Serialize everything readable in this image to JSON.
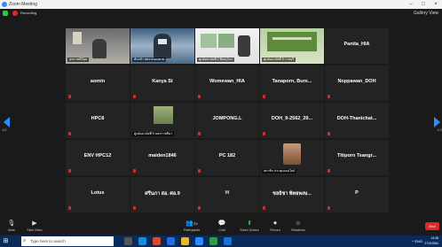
{
  "window": {
    "title": "Zoom Meeting",
    "minimize": "–",
    "maximize": "□",
    "close": "×"
  },
  "meeting": {
    "recording_label": "Recording",
    "view_button": "Gallery View"
  },
  "pagination": {
    "prev_page": "1/2",
    "next_page": "1/2"
  },
  "tiles": [
    {
      "name": "",
      "video_label": "สุขภาพดีมีสุข"
    },
    {
      "name": "",
      "video_label": "ต้นกล้า สสจ.หนองคาย"
    },
    {
      "name": "",
      "video_label": "ศูนย์อนามัยที่ 2 พิษณุโลก"
    },
    {
      "name": "",
      "video_label": "ศูนย์อนามัยที่ 5 ราชบุรี"
    },
    {
      "name": "Panita_HIA",
      "video_label": ""
    },
    {
      "name": "aomin",
      "video_label": ""
    },
    {
      "name": "Kanya St",
      "video_label": ""
    },
    {
      "name": "Womewan_HIA",
      "video_label": ""
    },
    {
      "name": "Tanaporn, Bure...",
      "video_label": ""
    },
    {
      "name": "Noppawan_DOH",
      "video_label": ""
    },
    {
      "name": "HPC8",
      "video_label": ""
    },
    {
      "name": "",
      "video_label": "ศูนย์อนามัยที่ 9 นครราชสีมา"
    },
    {
      "name": "JOMPONG.L",
      "video_label": ""
    },
    {
      "name": "DOH_9-2562_29...",
      "video_label": ""
    },
    {
      "name": "DOH-Thanichat...",
      "video_label": ""
    },
    {
      "name": "ENV HPC12",
      "video_label": ""
    },
    {
      "name": "maiden1846",
      "video_label": ""
    },
    {
      "name": "PC 182",
      "video_label": ""
    },
    {
      "name": "",
      "video_label": "สมาชิก ประชุมออนไลน์"
    },
    {
      "name": "Titiporn Tsangr...",
      "video_label": ""
    },
    {
      "name": "Lotus",
      "video_label": ""
    },
    {
      "name": "ศรีนภา สอ. ศอ.9",
      "video_label": ""
    },
    {
      "name": "H",
      "video_label": ""
    },
    {
      "name": "ชลธิชา พิทยพงษ...",
      "video_label": ""
    },
    {
      "name": "P",
      "video_label": ""
    }
  ],
  "toolbar": {
    "mute": "Mute",
    "start_video": "Start Video",
    "participants": "Participants",
    "participants_count": "25",
    "chat": "Chat",
    "share_screen": "Share Screen",
    "record": "Record",
    "reactions": "Reactions",
    "end": "End"
  },
  "taskbar": {
    "search_placeholder": "Type here to search",
    "tray_text": "^ ENG",
    "time": "14:36",
    "date": "27/4/2564"
  },
  "colors": {
    "accent": "#2d8cff",
    "muted_red": "#e02828",
    "active_speaker": "#e6d63a",
    "taskbar": "#0a2a5a"
  }
}
